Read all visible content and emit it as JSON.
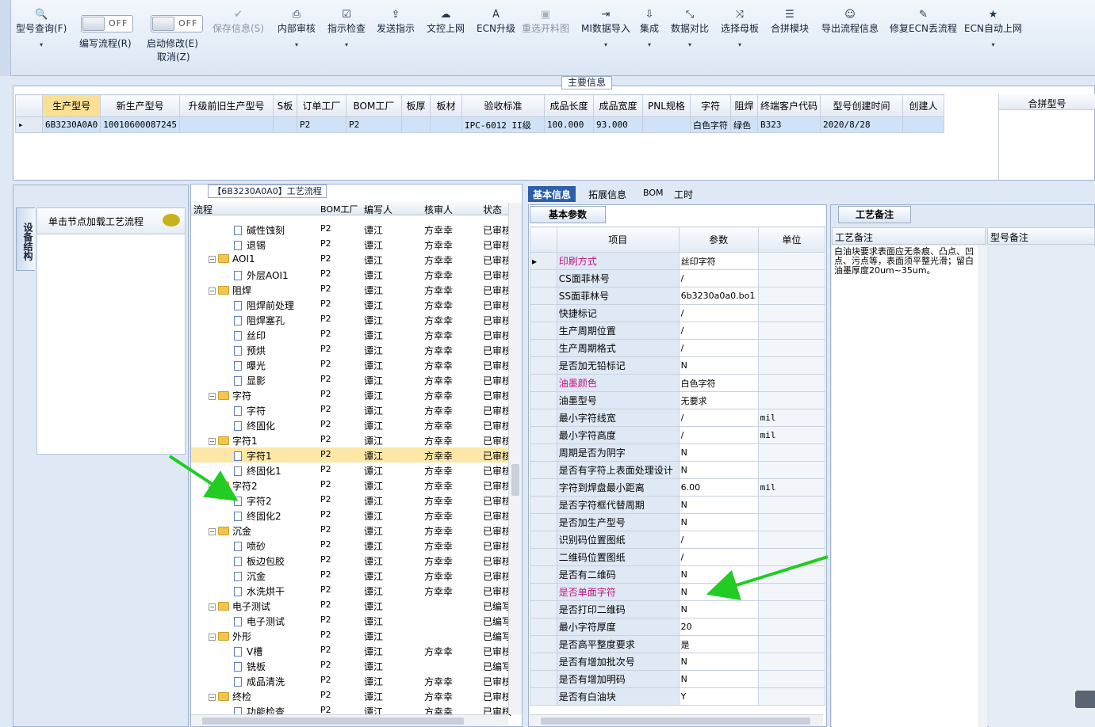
{
  "toolbar": {
    "items": [
      {
        "label": "型号查询(F)",
        "icon": "search-icon",
        "enabled": true,
        "dropdown": true
      },
      {
        "label": "保存信息(S)",
        "icon": "check-icon",
        "enabled": false,
        "dropdown": false
      },
      {
        "label": "内部审核",
        "icon": "printer-icon",
        "enabled": true,
        "dropdown": true
      },
      {
        "label": "指示检查",
        "icon": "checkbox-icon",
        "enabled": true,
        "dropdown": true
      },
      {
        "label": "发送指示",
        "icon": "upload-icon",
        "enabled": true,
        "dropdown": false
      },
      {
        "label": "文控上网",
        "icon": "cloud-icon",
        "enabled": true,
        "dropdown": false
      },
      {
        "label": "ECN升级",
        "icon": "font-icon",
        "enabled": true,
        "dropdown": false
      },
      {
        "label": "重选开料图",
        "icon": "image-icon",
        "enabled": false,
        "dropdown": false
      },
      {
        "label": "MI数据导入",
        "icon": "import-icon",
        "enabled": true,
        "dropdown": true
      },
      {
        "label": "集成",
        "icon": "download-icon",
        "enabled": true,
        "dropdown": true
      },
      {
        "label": "数据对比",
        "icon": "compress-icon",
        "enabled": true,
        "dropdown": true
      },
      {
        "label": "选择母板",
        "icon": "shuffle-icon",
        "enabled": true,
        "dropdown": true
      },
      {
        "label": "合拼模块",
        "icon": "list-icon",
        "enabled": true,
        "dropdown": false
      },
      {
        "label": "导出流程信息",
        "icon": "smile-icon",
        "enabled": true,
        "dropdown": false
      },
      {
        "label": "修复ECN丢流程",
        "icon": "wrench-icon",
        "enabled": true,
        "dropdown": false
      },
      {
        "label": "ECN自动上网",
        "icon": "star-icon",
        "enabled": true,
        "dropdown": true
      }
    ],
    "toggle1": {
      "state": "OFF",
      "label": "编写流程(R)"
    },
    "toggle2": {
      "state": "OFF",
      "label": "启动修改(E)",
      "label2": "取消(Z)"
    }
  },
  "main_info": {
    "title": "主要信息",
    "columns": [
      "生产型号",
      "新生产型号",
      "升级前旧生产型号",
      "S板",
      "订单工厂",
      "BOM工厂",
      "板厚",
      "板材",
      "验收标准",
      "成品长度",
      "成品宽度",
      "PNL规格",
      "字符",
      "阻焊",
      "终端客户代码",
      "型号创建时间",
      "创建人"
    ],
    "row": [
      "6B3230A0A0",
      "10010600087245",
      "",
      "",
      "P2",
      "P2",
      "",
      "",
      "IPC-6012 II级",
      "100.000",
      "93.000",
      "",
      "白色字符",
      "绿色",
      "B323",
      "2020/8/28",
      ""
    ],
    "side_header": "合拼型号"
  },
  "left_panel": {
    "vertical_tab": "设备结构",
    "node_prompt": "单击节点加载工艺流程"
  },
  "process": {
    "title": "【6B3230A0A0】工艺流程",
    "columns": [
      "流程",
      "BOM工厂",
      "编写人",
      "核审人",
      "状态"
    ],
    "rows": [
      {
        "level": 2,
        "type": "doc",
        "name": "碱性蚀刻",
        "bom": "P2",
        "author": "谭江",
        "reviewer": "方幸幸",
        "status": "已审核"
      },
      {
        "level": 2,
        "type": "doc",
        "name": "退锡",
        "bom": "P2",
        "author": "谭江",
        "reviewer": "方幸幸",
        "status": "已审核"
      },
      {
        "level": 1,
        "type": "folder",
        "name": "AOI1",
        "bom": "P2",
        "author": "谭江",
        "reviewer": "方幸幸",
        "status": "已审核"
      },
      {
        "level": 2,
        "type": "doc",
        "name": "外层AOI1",
        "bom": "P2",
        "author": "谭江",
        "reviewer": "方幸幸",
        "status": "已审核"
      },
      {
        "level": 1,
        "type": "folder",
        "name": "阻焊",
        "bom": "P2",
        "author": "谭江",
        "reviewer": "方幸幸",
        "status": "已审核"
      },
      {
        "level": 2,
        "type": "doc",
        "name": "阻焊前处理",
        "bom": "P2",
        "author": "谭江",
        "reviewer": "方幸幸",
        "status": "已审核"
      },
      {
        "level": 2,
        "type": "doc",
        "name": "阻焊塞孔",
        "bom": "P2",
        "author": "谭江",
        "reviewer": "方幸幸",
        "status": "已审核"
      },
      {
        "level": 2,
        "type": "doc",
        "name": "丝印",
        "bom": "P2",
        "author": "谭江",
        "reviewer": "方幸幸",
        "status": "已审核"
      },
      {
        "level": 2,
        "type": "doc",
        "name": "预烘",
        "bom": "P2",
        "author": "谭江",
        "reviewer": "方幸幸",
        "status": "已审核"
      },
      {
        "level": 2,
        "type": "doc",
        "name": "曝光",
        "bom": "P2",
        "author": "谭江",
        "reviewer": "方幸幸",
        "status": "已审核"
      },
      {
        "level": 2,
        "type": "doc",
        "name": "显影",
        "bom": "P2",
        "author": "谭江",
        "reviewer": "方幸幸",
        "status": "已审核"
      },
      {
        "level": 1,
        "type": "folder",
        "name": "字符",
        "bom": "P2",
        "author": "谭江",
        "reviewer": "方幸幸",
        "status": "已审核"
      },
      {
        "level": 2,
        "type": "doc",
        "name": "字符",
        "bom": "P2",
        "author": "谭江",
        "reviewer": "方幸幸",
        "status": "已审核"
      },
      {
        "level": 2,
        "type": "doc",
        "name": "终固化",
        "bom": "P2",
        "author": "谭江",
        "reviewer": "方幸幸",
        "status": "已审核"
      },
      {
        "level": 1,
        "type": "folder",
        "name": "字符1",
        "bom": "P2",
        "author": "谭江",
        "reviewer": "方幸幸",
        "status": "已审核"
      },
      {
        "level": 2,
        "type": "doc",
        "name": "字符1",
        "bom": "P2",
        "author": "谭江",
        "reviewer": "方幸幸",
        "status": "已审核",
        "selected": true
      },
      {
        "level": 2,
        "type": "doc",
        "name": "终固化1",
        "bom": "P2",
        "author": "谭江",
        "reviewer": "方幸幸",
        "status": "已审核"
      },
      {
        "level": 1,
        "type": "folder",
        "name": "字符2",
        "bom": "P2",
        "author": "谭江",
        "reviewer": "方幸幸",
        "status": "已审核"
      },
      {
        "level": 2,
        "type": "doc",
        "name": "字符2",
        "bom": "P2",
        "author": "谭江",
        "reviewer": "方幸幸",
        "status": "已审核"
      },
      {
        "level": 2,
        "type": "doc",
        "name": "终固化2",
        "bom": "P2",
        "author": "谭江",
        "reviewer": "方幸幸",
        "status": "已审核"
      },
      {
        "level": 1,
        "type": "folder",
        "name": "沉金",
        "bom": "P2",
        "author": "谭江",
        "reviewer": "方幸幸",
        "status": "已审核"
      },
      {
        "level": 2,
        "type": "doc",
        "name": "喷砂",
        "bom": "P2",
        "author": "谭江",
        "reviewer": "方幸幸",
        "status": "已审核"
      },
      {
        "level": 2,
        "type": "doc",
        "name": "板边包胶",
        "bom": "P2",
        "author": "谭江",
        "reviewer": "方幸幸",
        "status": "已审核"
      },
      {
        "level": 2,
        "type": "doc",
        "name": "沉金",
        "bom": "P2",
        "author": "谭江",
        "reviewer": "方幸幸",
        "status": "已审核"
      },
      {
        "level": 2,
        "type": "doc",
        "name": "水洗烘干",
        "bom": "P2",
        "author": "谭江",
        "reviewer": "方幸幸",
        "status": "已审核"
      },
      {
        "level": 1,
        "type": "folder",
        "name": "电子测试",
        "bom": "P2",
        "author": "谭江",
        "reviewer": "",
        "status": "已编写"
      },
      {
        "level": 2,
        "type": "doc",
        "name": "电子测试",
        "bom": "P2",
        "author": "谭江",
        "reviewer": "",
        "status": "已编写"
      },
      {
        "level": 1,
        "type": "folder",
        "name": "外形",
        "bom": "P2",
        "author": "谭江",
        "reviewer": "",
        "status": "已编写"
      },
      {
        "level": 2,
        "type": "doc",
        "name": "V槽",
        "bom": "P2",
        "author": "谭江",
        "reviewer": "方幸幸",
        "status": "已审核"
      },
      {
        "level": 2,
        "type": "doc",
        "name": "铣板",
        "bom": "P2",
        "author": "谭江",
        "reviewer": "",
        "status": "已编写"
      },
      {
        "level": 2,
        "type": "doc",
        "name": "成品清洗",
        "bom": "P2",
        "author": "谭江",
        "reviewer": "方幸幸",
        "status": "已审核"
      },
      {
        "level": 1,
        "type": "folder",
        "name": "终检",
        "bom": "P2",
        "author": "谭江",
        "reviewer": "方幸幸",
        "status": "已审核"
      },
      {
        "level": 2,
        "type": "doc",
        "name": "功能检查",
        "bom": "P2",
        "author": "谭江",
        "reviewer": "方幸幸",
        "status": "已审核"
      }
    ]
  },
  "right_tabs": [
    "基本信息",
    "拓展信息",
    "BOM",
    "工时"
  ],
  "params": {
    "tab": "基本参数",
    "columns": [
      "项目",
      "参数",
      "单位"
    ],
    "rows": [
      {
        "k": "印刷方式",
        "v": "丝印字符",
        "u": "",
        "pink": true,
        "current": true
      },
      {
        "k": "CS面菲林号",
        "v": "/",
        "u": ""
      },
      {
        "k": "SS面菲林号",
        "v": "6b3230a0a0.bo1",
        "u": ""
      },
      {
        "k": "快捷标记",
        "v": "/",
        "u": ""
      },
      {
        "k": "生产周期位置",
        "v": "/",
        "u": ""
      },
      {
        "k": "生产周期格式",
        "v": "/",
        "u": ""
      },
      {
        "k": "是否加无铅标记",
        "v": "N",
        "u": ""
      },
      {
        "k": "油墨颜色",
        "v": "白色字符",
        "u": "",
        "pink": true
      },
      {
        "k": "油墨型号",
        "v": "无要求",
        "u": ""
      },
      {
        "k": "最小字符线宽",
        "v": "/",
        "u": "mil"
      },
      {
        "k": "最小字符高度",
        "v": "/",
        "u": "mil"
      },
      {
        "k": "周期是否为阴字",
        "v": "N",
        "u": ""
      },
      {
        "k": "是否有字符上表面处理设计",
        "v": "N",
        "u": ""
      },
      {
        "k": "字符到焊盘最小距离",
        "v": "6.00",
        "u": "mil"
      },
      {
        "k": "是否字符框代替周期",
        "v": "N",
        "u": ""
      },
      {
        "k": "是否加生产型号",
        "v": "N",
        "u": ""
      },
      {
        "k": "识别码位置图纸",
        "v": "/",
        "u": ""
      },
      {
        "k": "二维码位置图纸",
        "v": "/",
        "u": ""
      },
      {
        "k": "是否有二维码",
        "v": "N",
        "u": ""
      },
      {
        "k": "是否单面字符",
        "v": "N",
        "u": "",
        "pink": true
      },
      {
        "k": "是否打印二维码",
        "v": "N",
        "u": ""
      },
      {
        "k": "最小字符厚度",
        "v": "20",
        "u": ""
      },
      {
        "k": "是否高平整度要求",
        "v": "是",
        "u": ""
      },
      {
        "k": "是否有增加批次号",
        "v": "N",
        "u": ""
      },
      {
        "k": "是否有增加明码",
        "v": "N",
        "u": ""
      },
      {
        "k": "是否有白油块",
        "v": "Y",
        "u": ""
      }
    ]
  },
  "remarks": {
    "tab": "工艺备注",
    "col1": "工艺备注",
    "col2": "型号备注",
    "text": "白油块要求表面应无条痕、凸点、凹点、污点等，表面须平整光滑；留白油墨厚度20um~35um。"
  },
  "colors": {
    "accent": "#2b5fa7",
    "highlight": "#fbe094",
    "pink": "#c0127e",
    "arrow": "#22cc22"
  }
}
